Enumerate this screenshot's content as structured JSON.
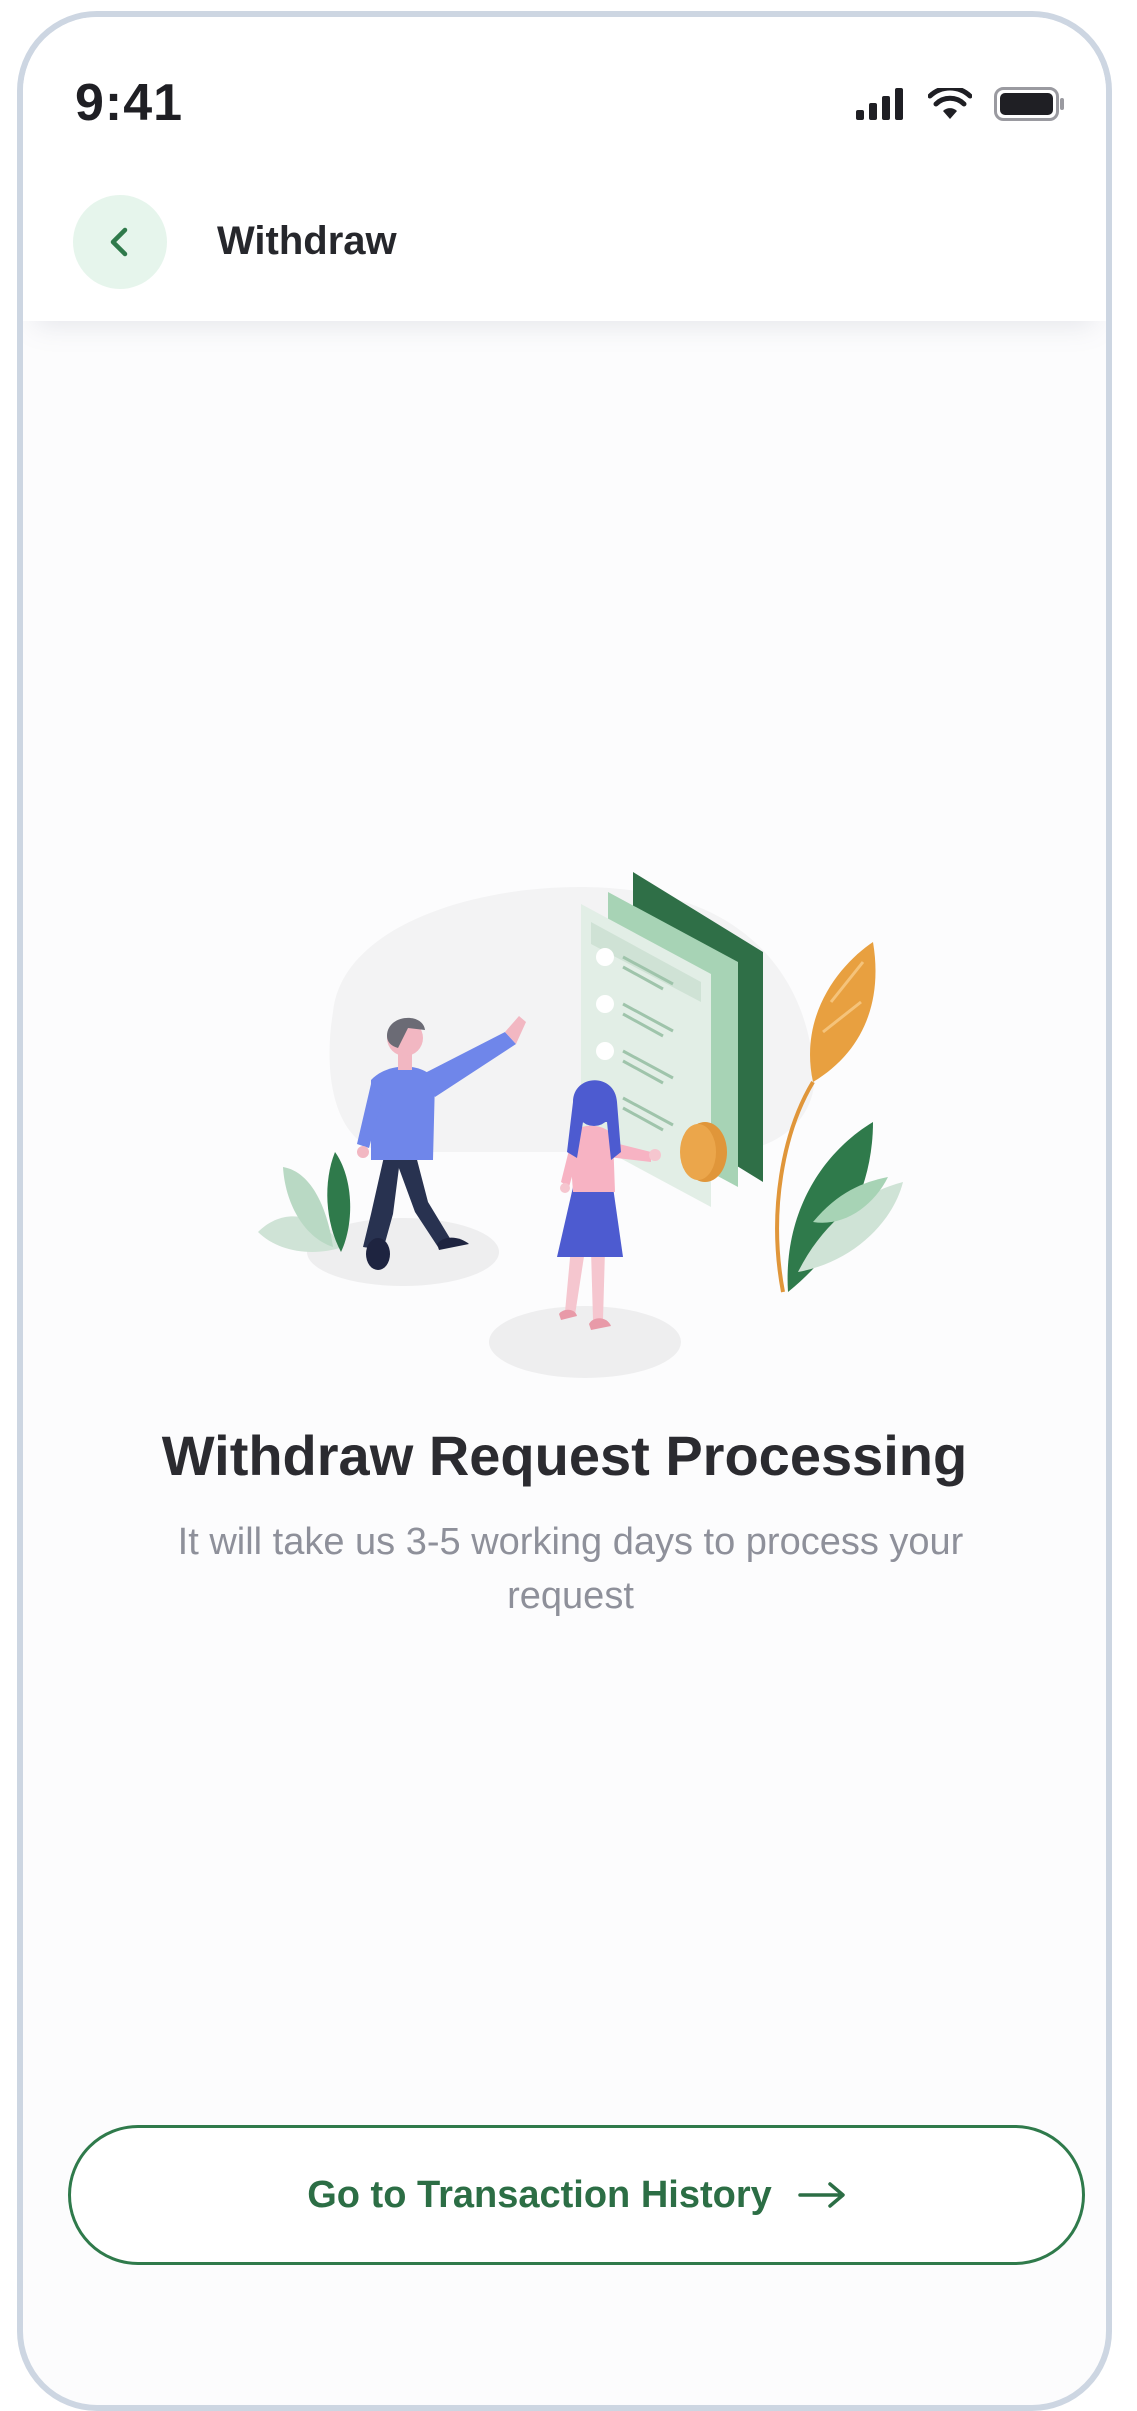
{
  "status_bar": {
    "time": "9:41",
    "icons": [
      "signal-icon",
      "wifi-icon",
      "battery-icon"
    ]
  },
  "header": {
    "title": "Withdraw",
    "back_icon": "chevron-left-icon"
  },
  "content": {
    "illustration": "withdraw-processing-illustration",
    "title": "Withdraw Request Processing",
    "subtitle": "It will take us 3-5 working days to process your request"
  },
  "cta": {
    "label": "Go to Transaction History",
    "icon": "arrow-right-icon"
  },
  "colors": {
    "accent": "#2f7a4b",
    "accent_light": "#e6f5ec",
    "text_dark": "#2b2b30",
    "text_muted": "#8e909a",
    "frame": "#cdd6e2"
  }
}
